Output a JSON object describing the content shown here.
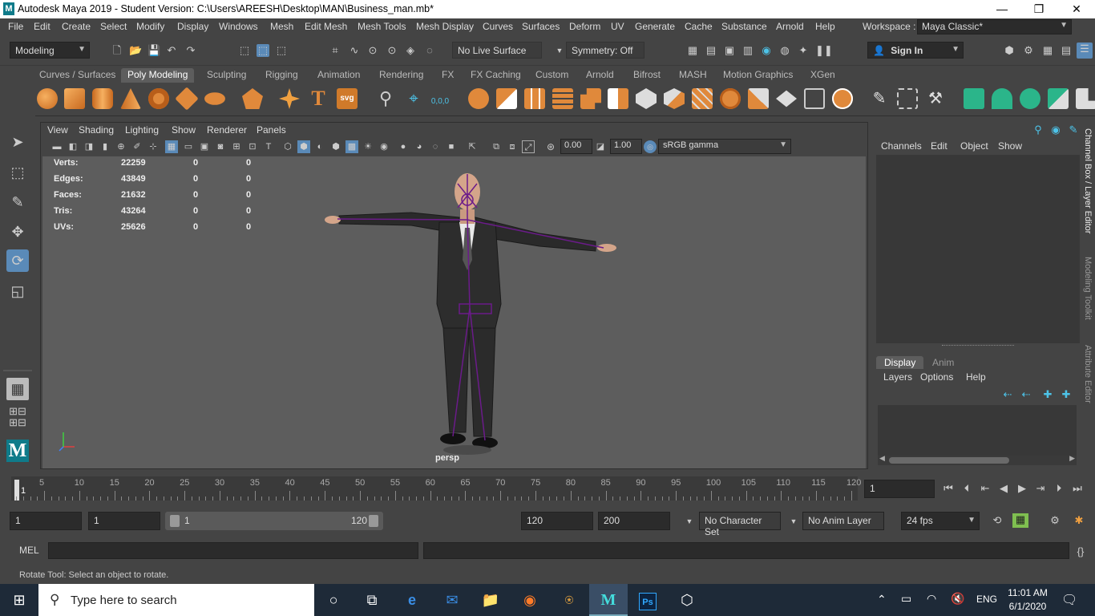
{
  "window": {
    "title": "Autodesk Maya 2019 - Student Version: C:\\Users\\AREESH\\Desktop\\MAN\\Business_man.mb*",
    "minimize": "—",
    "restore": "❐",
    "close": "✕"
  },
  "menubar": {
    "items": [
      "File",
      "Edit",
      "Create",
      "Select",
      "Modify",
      "Display",
      "Windows",
      "Mesh",
      "Edit Mesh",
      "Mesh Tools",
      "Mesh Display",
      "Curves",
      "Surfaces",
      "Deform",
      "UV",
      "Generate",
      "Cache",
      "Substance",
      "Arnold",
      "Help"
    ],
    "workspace_label": "Workspace :",
    "workspace_value": "Maya Classic*"
  },
  "statusline": {
    "mode": "Modeling",
    "live_surface": "No Live Surface",
    "symmetry": "Symmetry: Off",
    "sign_in": "Sign In"
  },
  "shelf": {
    "tabs": [
      "Curves / Surfaces",
      "Poly Modeling",
      "Sculpting",
      "Rigging",
      "Animation",
      "Rendering",
      "FX",
      "FX Caching",
      "Custom",
      "Arnold",
      "Bifrost",
      "MASH",
      "Motion Graphics",
      "XGen"
    ],
    "active_tab": "Poly Modeling",
    "svg_label": "svg",
    "xyz_label": "0,0,0"
  },
  "viewport": {
    "menu": [
      "View",
      "Shading",
      "Lighting",
      "Show",
      "Renderer",
      "Panels"
    ],
    "exposure": "0.00",
    "gamma": "1.00",
    "color_space": "sRGB gamma",
    "camera_label": "persp",
    "hud": [
      {
        "label": "Verts:",
        "value": "22259",
        "sel": "0",
        "uv": "0"
      },
      {
        "label": "Edges:",
        "value": "43849",
        "sel": "0",
        "uv": "0"
      },
      {
        "label": "Faces:",
        "value": "21632",
        "sel": "0",
        "uv": "0"
      },
      {
        "label": "Tris:",
        "value": "43264",
        "sel": "0",
        "uv": "0"
      },
      {
        "label": "UVs:",
        "value": "25626",
        "sel": "0",
        "uv": "0"
      }
    ]
  },
  "channelbox": {
    "menu": [
      "Channels",
      "Edit",
      "Object",
      "Show"
    ],
    "vertical_tabs": [
      "Channel Box / Layer Editor",
      "Modeling Toolkit",
      "Attribute Editor"
    ]
  },
  "layer_editor": {
    "tabs": [
      "Display",
      "Anim"
    ],
    "active_tab": "Display",
    "menu": [
      "Layers",
      "Options",
      "Help"
    ]
  },
  "timeline": {
    "ticks": [
      "1",
      "5",
      "10",
      "15",
      "20",
      "25",
      "30",
      "35",
      "40",
      "45",
      "50",
      "55",
      "60",
      "65",
      "70",
      "75",
      "80",
      "85",
      "90",
      "95",
      "100",
      "105",
      "110",
      "115",
      "120"
    ],
    "current_frame": "1"
  },
  "range": {
    "start": "1",
    "playback_start": "1",
    "slider_start": "1",
    "slider_end": "120",
    "playback_end": "120",
    "end": "200",
    "character_set": "No Character Set",
    "anim_layer": "No Anim Layer",
    "fps": "24 fps"
  },
  "command_line": {
    "label": "MEL"
  },
  "help_line": {
    "text": "Rotate Tool: Select an object to rotate."
  },
  "taskbar": {
    "search_placeholder": "Type here to search",
    "language": "ENG",
    "time": "11:01 AM",
    "date": "6/1/2020"
  }
}
